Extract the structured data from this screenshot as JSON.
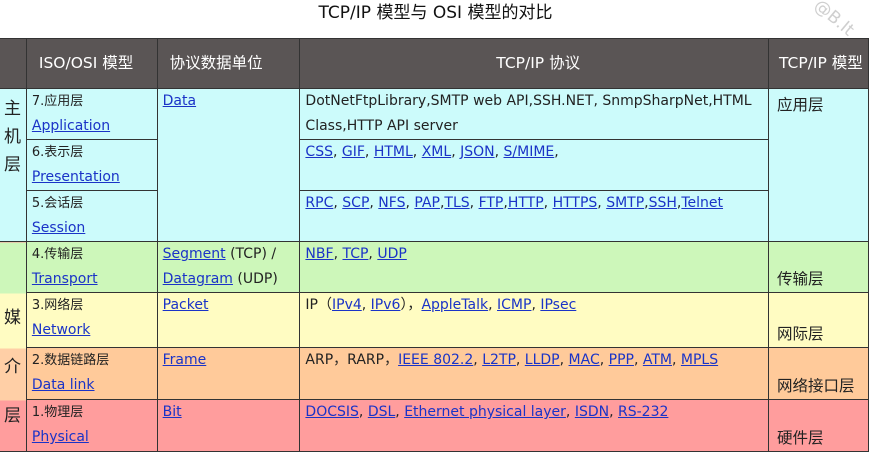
{
  "title": "TCP/IP 模型与 OSI 模型的对比",
  "watermark": "@B.It",
  "headers": {
    "side": "",
    "osi": "ISO/OSI 模型",
    "unit": "协议数据单位",
    "protocols": "TCP/IP 协议",
    "tcpip": "TCP/IP 模型"
  },
  "side_groups": {
    "host": [
      "主",
      "机",
      "层"
    ],
    "media": [
      "媒",
      "介",
      "层"
    ]
  },
  "rows": [
    {
      "layer_cn": "7.应用层",
      "layer_en": "Application",
      "unit_links": [
        "Data"
      ],
      "protocols_text": "DotNetFtpLibrary,SMTP web API,SSH.NET, SnmpSharpNet,HTML Class,HTTP API server",
      "tcpip": "应用层"
    },
    {
      "layer_cn": "6.表示层",
      "layer_en": "Presentation",
      "protocols_links": [
        "CSS",
        "GIF",
        "HTML",
        "XML",
        "JSON",
        "S/MIME"
      ]
    },
    {
      "layer_cn": "5.会话层",
      "layer_en": "Session",
      "protocols_links": [
        "RPC",
        "SCP",
        "NFS",
        "PAP",
        "TLS",
        "FTP",
        "HTTP",
        "HTTPS",
        "SMTP",
        "SSH",
        "Telnet"
      ]
    },
    {
      "layer_cn": "4.传输层",
      "layer_en": "Transport",
      "unit_link_1": "Segment",
      "unit_text_1": " (TCP) /",
      "unit_link_2": "Datagram",
      "unit_text_2": " (UDP)",
      "protocols_links": [
        "NBF",
        "TCP",
        "UDP"
      ],
      "tcpip": "传输层"
    },
    {
      "layer_cn": "3.网络层",
      "layer_en": "Network",
      "unit_links": [
        "Packet"
      ],
      "protocols_prefix": "IP（",
      "protocols_links_a": [
        "IPv4",
        "IPv6"
      ],
      "protocols_mid": "），",
      "protocols_links_b": [
        "AppleTalk",
        "ICMP",
        "IPsec"
      ],
      "tcpip": "网际层"
    },
    {
      "layer_cn": "2.数据链路层",
      "layer_en": "Data link",
      "unit_links": [
        "Frame"
      ],
      "protocols_prefix": "ARP，RARP，",
      "protocols_links": [
        "IEEE 802.2",
        "L2TP",
        "LLDP",
        "MAC",
        "PPP",
        "ATM",
        "MPLS"
      ],
      "tcpip": "网络接口层"
    },
    {
      "layer_cn": "1.物理层",
      "layer_en": "Physical",
      "unit_links": [
        "Bit"
      ],
      "protocols_links": [
        "DOCSIS",
        "DSL",
        "Ethernet physical layer",
        "ISDN",
        "RS-232"
      ],
      "tcpip": "硬件层"
    }
  ],
  "colors": {
    "header_bg": "#5a5555",
    "application": "#ccfbfb",
    "transport": "#cdf7ba",
    "network": "#fffcc2",
    "data_link": "#ffca9a",
    "physical": "#ff9d9d",
    "link": "#1a33c7"
  }
}
